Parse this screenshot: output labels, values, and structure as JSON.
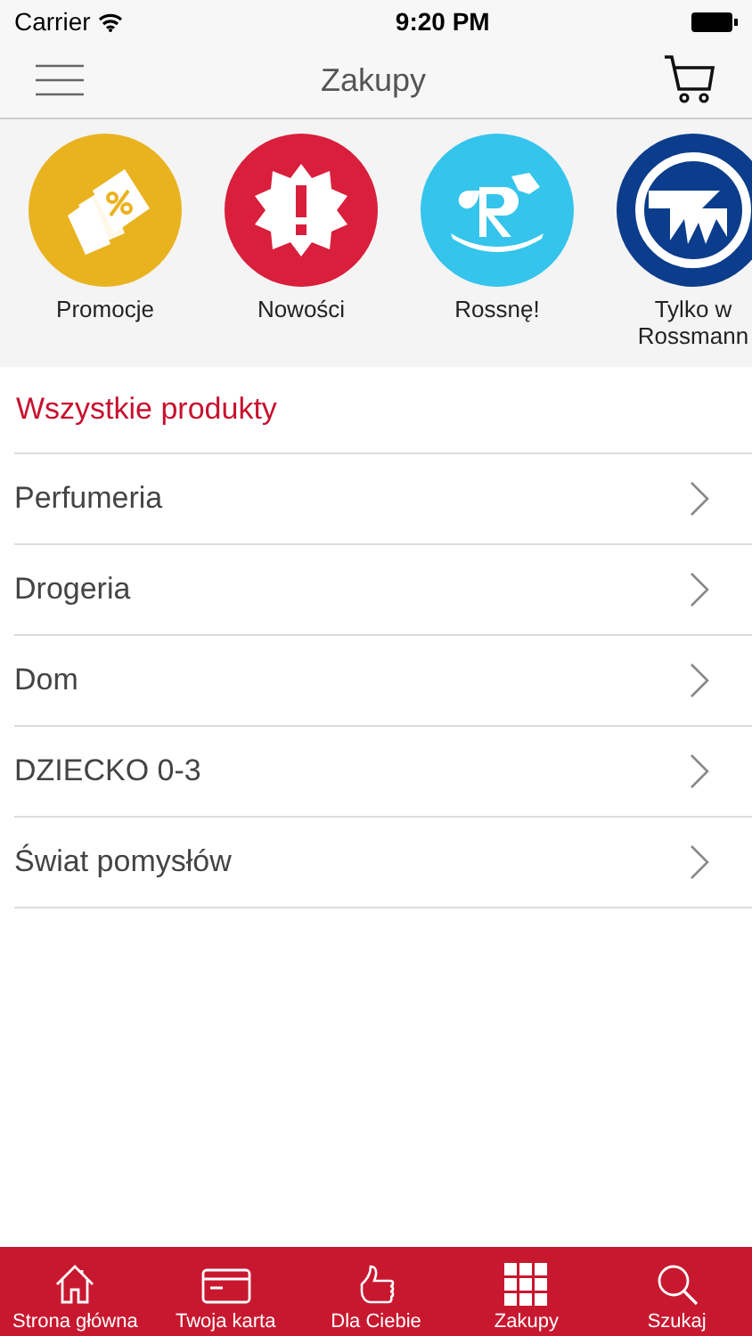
{
  "status_bar": {
    "carrier": "Carrier",
    "time": "9:20 PM"
  },
  "nav": {
    "title": "Zakupy"
  },
  "categories": [
    {
      "label": "Promocje",
      "color": "#e9b320",
      "kind": "tags"
    },
    {
      "label": "Nowości",
      "color": "#d91f3c",
      "kind": "burst"
    },
    {
      "label": "Rossnę!",
      "color": "#34c4ec",
      "kind": "horse"
    },
    {
      "label": "Tylko w Rossmann",
      "color": "#0b3d8c",
      "kind": "logo"
    }
  ],
  "section_title": "Wszystkie produkty",
  "products": [
    "Perfumeria",
    "Drogeria",
    "Dom",
    "DZIECKO 0-3",
    "Świat pomysłów"
  ],
  "tabs": [
    {
      "label": "Strona główna",
      "kind": "home"
    },
    {
      "label": "Twoja karta",
      "kind": "card"
    },
    {
      "label": "Dla Ciebie",
      "kind": "thumb"
    },
    {
      "label": "Zakupy",
      "kind": "grid"
    },
    {
      "label": "Szukaj",
      "kind": "search"
    }
  ]
}
